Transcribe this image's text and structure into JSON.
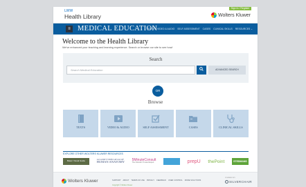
{
  "header": {
    "brand_prefix": "LWW",
    "brand_name": "Health Library",
    "signin_label": "Sign In / Register",
    "wk_logo_text": "Wolters Kluwer"
  },
  "nav": {
    "menu_icon": "menu-icon",
    "site_title": "MEDICAL EDUCATION",
    "links": [
      "TEXTS",
      "VIDEO & AUDIO",
      "SELF ASSESSMENT",
      "CASES",
      "CLINICAL SKILLS",
      "RESOURCES ⌄"
    ]
  },
  "welcome": {
    "title": "Welcome to the Health Library",
    "subtitle": "We've enhanced your teaching and learning experience. Search or browse our site to see how!"
  },
  "search": {
    "heading": "Search",
    "placeholder": "Search Medical Education",
    "button_icon": "search-icon",
    "advanced_label": "ADVANCED SEARCH"
  },
  "or_label": "OR",
  "browse": {
    "heading": "Browse",
    "tiles": [
      {
        "label": "TEXTS",
        "icon": "book-icon"
      },
      {
        "label": "VIDEO & AUDIO",
        "icon": "video-play-icon"
      },
      {
        "label": "SELF ASSESSMENT",
        "icon": "checkbox-icon"
      },
      {
        "label": "CASES",
        "icon": "folder-icon"
      },
      {
        "label": "CLINICAL SKILLS",
        "icon": "stethoscope-icon"
      }
    ]
  },
  "resources": {
    "label": "EXPLORE OTHER WOLTERS KLUWER RESOURCES",
    "bates": "Bates' Visual Guide",
    "anatomy_small": "ACLAND'S VIDEO ATLAS OF",
    "anatomy_big": "HUMAN ANATOMY",
    "five_minute": "5MinuteConsult",
    "five_minute_sub": "The Clinical's Trusted Expert",
    "prepu": "prepU",
    "thepoint": "thePoint",
    "stedmans": "STEDMANS"
  },
  "footer": {
    "wk_text": "Wolters Kluwer",
    "links": [
      "SUPPORT",
      "ABOUT",
      "TERMS OF USE",
      "PRIVACY",
      "FEEDBACK",
      "USER CONTROL",
      "MORE SOLUTIONS"
    ],
    "copyright": "Copyright © Wolters Kluwer",
    "powered_by": "POWERED BY",
    "silverchair": "SILVERCHAIR"
  },
  "colors": {
    "nav_blue": "#0a5d9e",
    "tile_blue": "#c5d8ea",
    "signin_green": "#85bc3f"
  }
}
